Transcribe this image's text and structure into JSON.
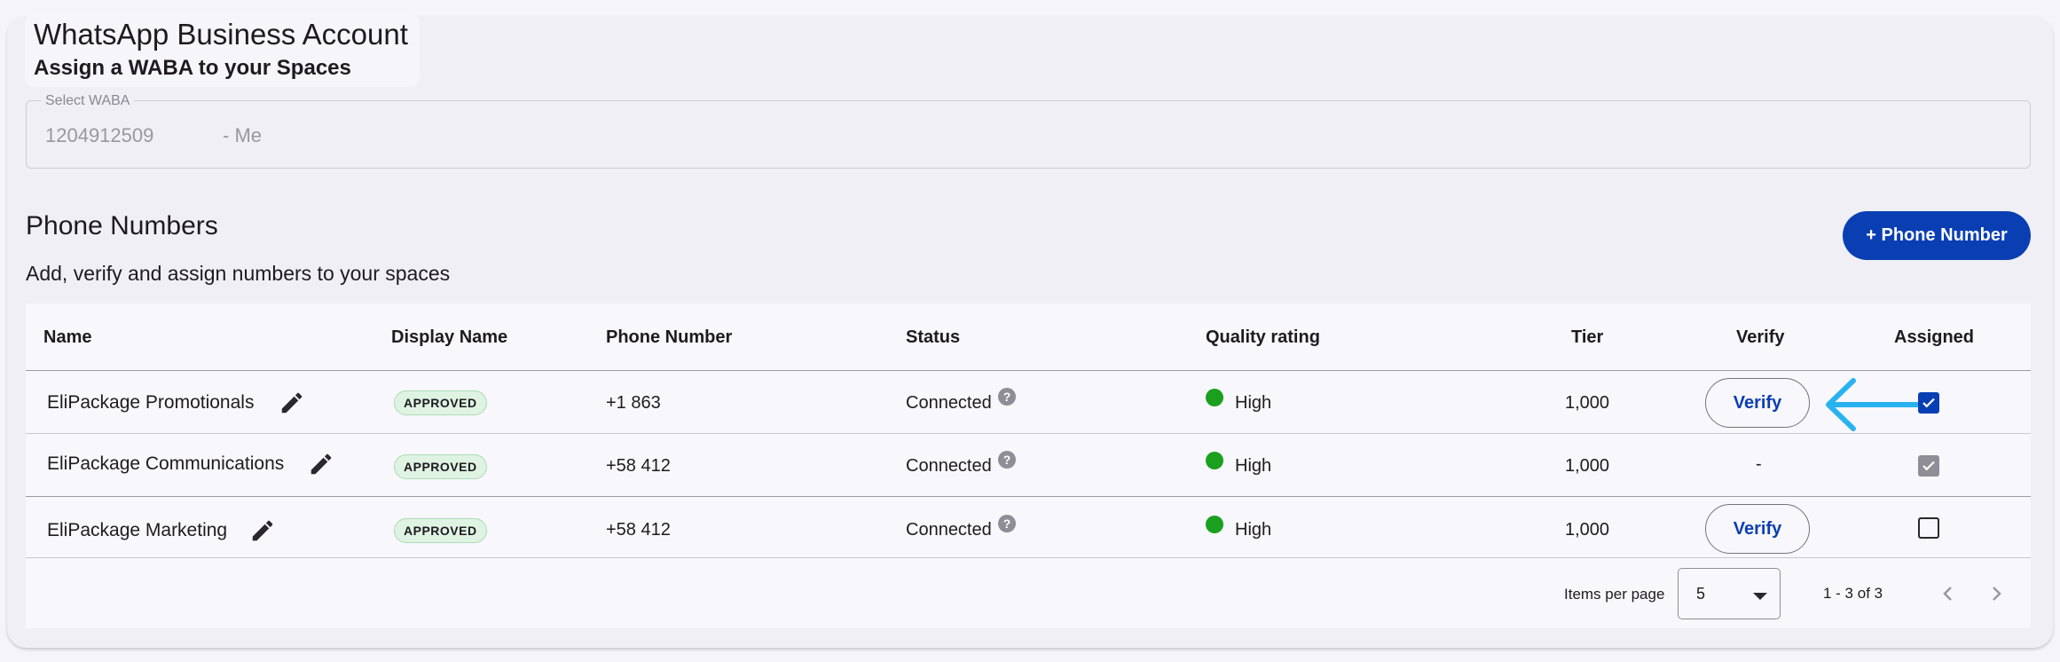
{
  "header": {
    "title": "WhatsApp Business Account",
    "subtitle": "Assign a WABA to your Spaces"
  },
  "waba_select": {
    "label": "Select WABA",
    "id": "1204912509",
    "owner": "- Me"
  },
  "phone_numbers": {
    "title": "Phone Numbers",
    "subtitle": "Add, verify and assign numbers to your spaces",
    "add_button": "+ Phone Number"
  },
  "table": {
    "columns": [
      "Name",
      "Display Name",
      "Phone Number",
      "Status",
      "Quality rating",
      "Tier",
      "Verify",
      "Assigned"
    ],
    "rows": [
      {
        "name": "EliPackage Promotionals",
        "display_name": "APPROVED",
        "phone": "+1 863",
        "status": "Connected",
        "quality": "High",
        "tier": "1,000",
        "verify": "Verify",
        "assigned": "checked"
      },
      {
        "name": "EliPackage Communications",
        "display_name": "APPROVED",
        "phone": "+58 412",
        "status": "Connected",
        "quality": "High",
        "tier": "1,000",
        "verify": "-",
        "assigned": "checked-disabled"
      },
      {
        "name": "EliPackage Marketing",
        "display_name": "APPROVED",
        "phone": "+58 412",
        "status": "Connected",
        "quality": "High",
        "tier": "1,000",
        "verify": "Verify",
        "assigned": "unchecked"
      }
    ]
  },
  "paginator": {
    "items_per_page_label": "Items per page",
    "items_per_page": "5",
    "range": "1 - 3 of 3"
  },
  "icons": [
    "edit-icon",
    "help-icon",
    "status-dot-icon",
    "arrow-left-icon",
    "chevron-left-icon",
    "chevron-right-icon",
    "dropdown-arrow-icon",
    "checkmark-icon"
  ],
  "colors": {
    "primary": "#0a3fb4",
    "quality_high": "#1aa01e",
    "approved_badge_bg": "#dff3e3",
    "annotation_arrow": "#29b2f0"
  }
}
